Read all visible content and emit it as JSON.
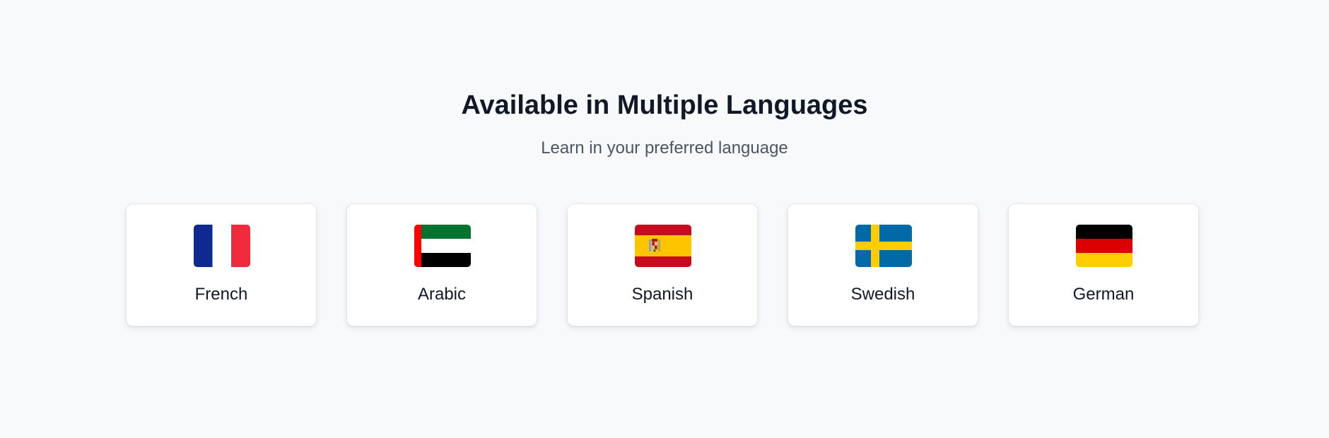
{
  "header": {
    "title": "Available in Multiple Languages",
    "subtitle": "Learn in your preferred language"
  },
  "languages": [
    {
      "name": "French",
      "flag_icon": "france-flag-icon",
      "colors": [
        "#0f2a8f",
        "#ffffff",
        "#ef2b3d"
      ]
    },
    {
      "name": "Arabic",
      "flag_icon": "uae-flag-icon",
      "colors": [
        "#ff0000",
        "#00732f",
        "#ffffff",
        "#000000"
      ]
    },
    {
      "name": "Spanish",
      "flag_icon": "spain-flag-icon",
      "colors": [
        "#c60b1e",
        "#ffc400"
      ]
    },
    {
      "name": "Swedish",
      "flag_icon": "sweden-flag-icon",
      "colors": [
        "#006aa7",
        "#fecc00"
      ]
    },
    {
      "name": "German",
      "flag_icon": "germany-flag-icon",
      "colors": [
        "#000000",
        "#dd0000",
        "#ffce00"
      ]
    }
  ]
}
